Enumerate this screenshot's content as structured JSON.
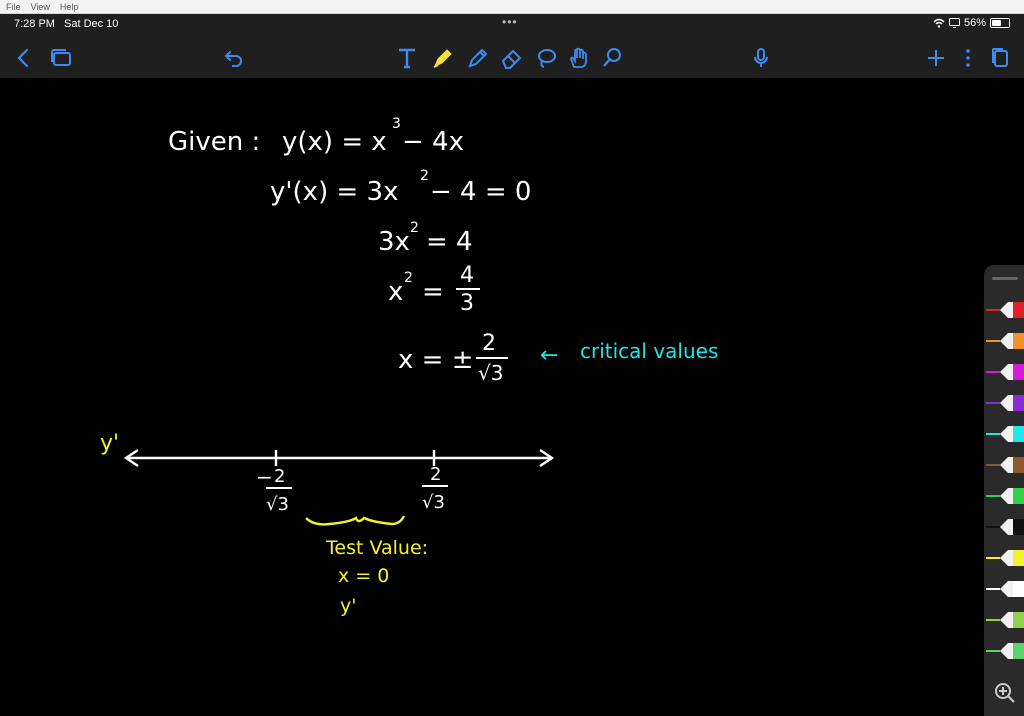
{
  "menubar": {
    "items": [
      "File",
      "View",
      "Help"
    ]
  },
  "status": {
    "time": "7:28 PM",
    "date": "Sat Dec 10",
    "dots": "•••",
    "battery": "56%",
    "battery_level": 0.56
  },
  "toolbar": {
    "tools": [
      "back-icon",
      "documents-icon",
      "undo-icon",
      "text-tool-icon",
      "highlighter-icon",
      "pen-icon",
      "eraser-icon",
      "lasso-icon",
      "hand-icon",
      "selection-icon",
      "microphone-icon",
      "add-icon",
      "more-icon",
      "pages-icon"
    ]
  },
  "note": {
    "line1_left": "Given :",
    "line1_eq": "y(x) = x",
    "line1_exp": "3",
    "line1_tail": "− 4x",
    "line2_eq": "y'(x) = 3x",
    "line2_exp": "2",
    "line2_tail": "− 4  = 0",
    "line3_lhs": "3x",
    "line3_exp": "2",
    "line3_rhs": "= 4",
    "line4_lhs": "x",
    "line4_exp": "2",
    "line4_eq": "=",
    "line4_num": "4",
    "line4_den": "3",
    "line5_lhs": "x = ±",
    "line5_num": "2",
    "line5_den": "√3",
    "annotation_arrow": "←",
    "annotation": "critical values",
    "numberline_label": "y'",
    "tick_left_sign": "−",
    "tick_left_num": "2",
    "tick_left_den": "√3",
    "tick_right_num": "2",
    "tick_right_den": "√3",
    "test_value_label": "Test Value:",
    "test_x": "x = 0",
    "test_y": "y'"
  },
  "colors": {
    "ink_white": "#ffffff",
    "ink_cyan": "#22e4ea",
    "ink_yellow": "#f4f32a",
    "toolbar_bg": "#1f1f1f",
    "icon_blue": "#3d8bf0",
    "highlighter_yellow": "#f2e13a"
  },
  "palette": {
    "pens": [
      "#e0202a",
      "#f2912a",
      "#d61bd6",
      "#8a2bd6",
      "#22e4ea",
      "#8a5a2b",
      "#33d14a",
      "#111111",
      "#f4f32a",
      "#ffffff",
      "#8fd14a",
      "#5bd16a"
    ]
  }
}
